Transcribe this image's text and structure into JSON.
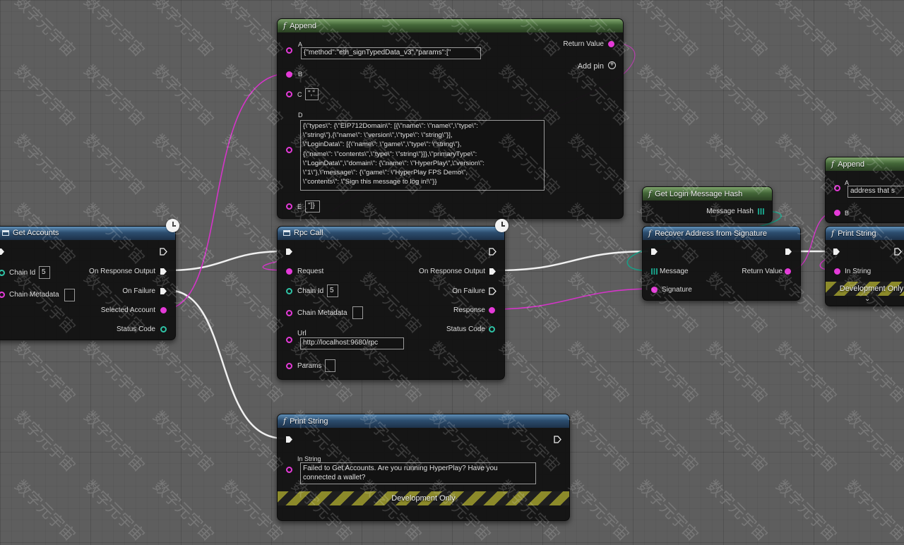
{
  "nodes": {
    "get_accounts": {
      "title": "Get Accounts",
      "chain_id_label": "Chain Id",
      "chain_id_value": "5",
      "chain_metadata_label": "Chain Metadata",
      "on_response_output_label": "On Response Output",
      "on_failure_label": "On Failure",
      "selected_account_label": "Selected Account",
      "status_code_label": "Status Code"
    },
    "append_main": {
      "title": "Append",
      "a_label": "A",
      "a_value": "{\"method\":\"eth_signTypedData_v3\",\"params\":[\"",
      "b_label": "B",
      "c_label": "C",
      "c_value": "\",\"",
      "d_label": "D",
      "d_value": "{\\\"types\\\": {\\\"EIP712Domain\\\": [{\\\"name\\\": \\\"name\\\",\\\"type\\\":\n\\\"string\\\"},{\\\"name\\\": \\\"version\\\",\\\"type\\\": \\\"string\\\"}],\n\\\"LoginData\\\": [{\\\"name\\\": \\\"game\\\",\\\"type\\\": \\\"string\\\"},\n{\\\"name\\\": \\\"contents\\\",\\\"type\\\": \\\"string\\\"}]},\\\"primaryType\\\":\n\\\"LoginData\\\",\\\"domain\\\": {\\\"name\\\": \\\"HyperPlay\\\",\\\"version\\\":\n\\\"1\\\"},\\\"message\\\": {\\\"game\\\": \\\"HyperPlay FPS Demo\\\",\n\\\"contents\\\": \\\"Sign this message to log in!\\\"}}",
      "e_label": "E",
      "e_value": "\"]}",
      "return_value_label": "Return Value",
      "add_pin_label": "Add pin"
    },
    "rpc_call": {
      "title": "Rpc Call",
      "request_label": "Request",
      "chain_id_label": "Chain Id",
      "chain_id_value": "5",
      "chain_metadata_label": "Chain Metadata",
      "url_label": "Url",
      "url_value": "http://localhost:9680/rpc",
      "params_label": "Params",
      "on_response_output_label": "On Response Output",
      "on_failure_label": "On Failure",
      "response_label": "Response",
      "status_code_label": "Status Code"
    },
    "get_login_message_hash": {
      "title": "Get Login Message Hash",
      "message_hash_label": "Message Hash"
    },
    "recover_address": {
      "title": "Recover Address from Signature",
      "message_label": "Message",
      "signature_label": "Signature",
      "return_value_label": "Return Value"
    },
    "append_right": {
      "title": "Append",
      "a_label": "A",
      "a_value": "address that s",
      "b_label": "B"
    },
    "print_string_right": {
      "title": "Print String",
      "in_string_label": "In String",
      "dev_only_label": "Development Only"
    },
    "print_string_bottom": {
      "title": "Print String",
      "in_string_label": "In String",
      "in_string_value": "Failed to Get Accounts. Are you running HyperPlay? Have you\nconnected a wallet?",
      "dev_only_label": "Development Only"
    }
  },
  "watermark_text": "数字元宇宙",
  "colors": {
    "exec_wire": "#f0f0f0",
    "string_pin": "#e43ad8",
    "int_pin": "#2fc3a6",
    "function_header": "#2c4d6e",
    "pure_header": "#436638",
    "background": "#5e5e5e"
  },
  "icons": {
    "latent_node": "clock-icon",
    "function": "function-icon",
    "macro": "macro-icon",
    "add_pin": "plus-circle-icon",
    "expand": "chevron-down-icon"
  }
}
